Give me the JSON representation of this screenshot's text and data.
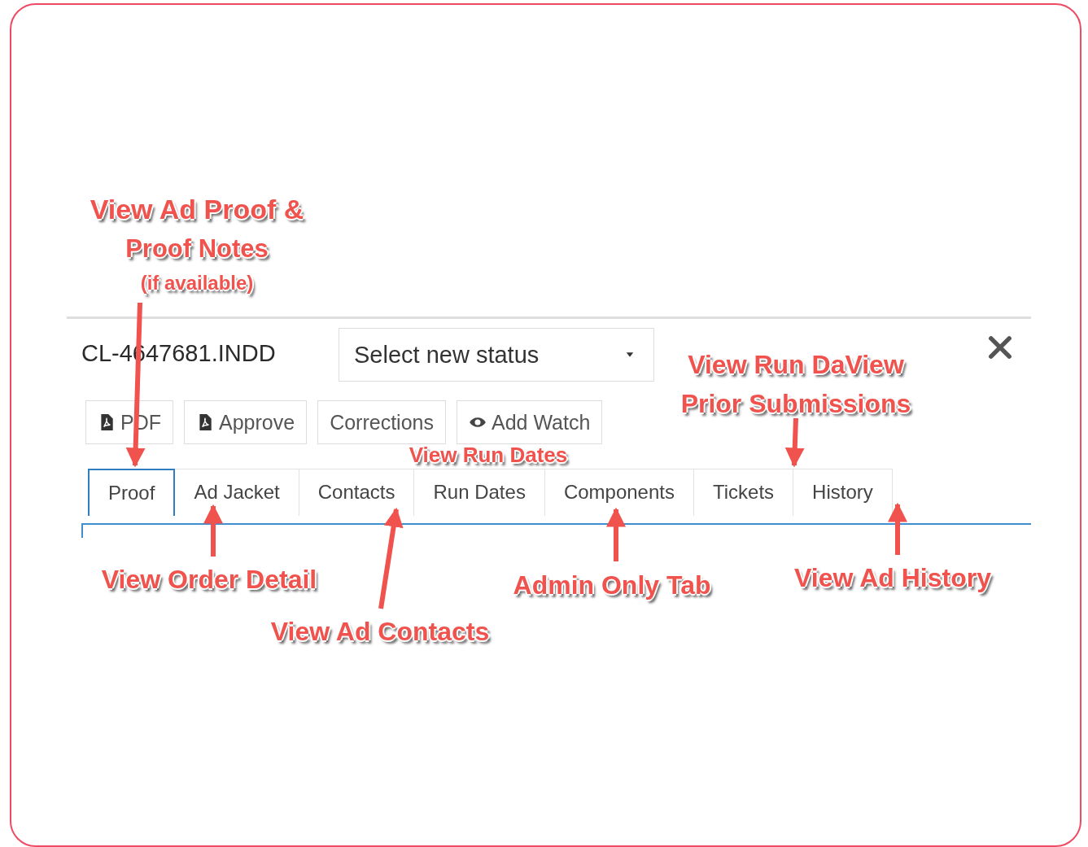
{
  "header": {
    "title": "CL-4647681.INDD",
    "status_select": {
      "placeholder": "Select new status"
    }
  },
  "actions": [
    {
      "label": "PDF",
      "kind": "file"
    },
    {
      "label": "Approve",
      "kind": "file"
    },
    {
      "label": "Corrections",
      "kind": "text"
    },
    {
      "label": "Add Watch",
      "kind": "eye"
    }
  ],
  "tabs": [
    {
      "label": "Proof",
      "selected": true
    },
    {
      "label": "Ad Jacket",
      "selected": false
    },
    {
      "label": "Contacts",
      "selected": false
    },
    {
      "label": "Run Dates",
      "selected": false
    },
    {
      "label": "Components",
      "selected": false
    },
    {
      "label": "Tickets",
      "selected": false
    },
    {
      "label": "History",
      "selected": false
    }
  ],
  "annotations": [
    {
      "lines": [
        "View Ad Proof &",
        "Proof Notes",
        "(if available)"
      ]
    },
    {
      "lines": [
        "View Run Dates"
      ]
    },
    {
      "lines": [
        "View Run DaView",
        "Prior Submissions"
      ]
    },
    {
      "lines": [
        "View Order Detail"
      ]
    },
    {
      "lines": [
        "View Ad Contacts"
      ]
    },
    {
      "lines": [
        "Admin Only Tab"
      ]
    },
    {
      "lines": [
        "View Ad History"
      ]
    }
  ]
}
